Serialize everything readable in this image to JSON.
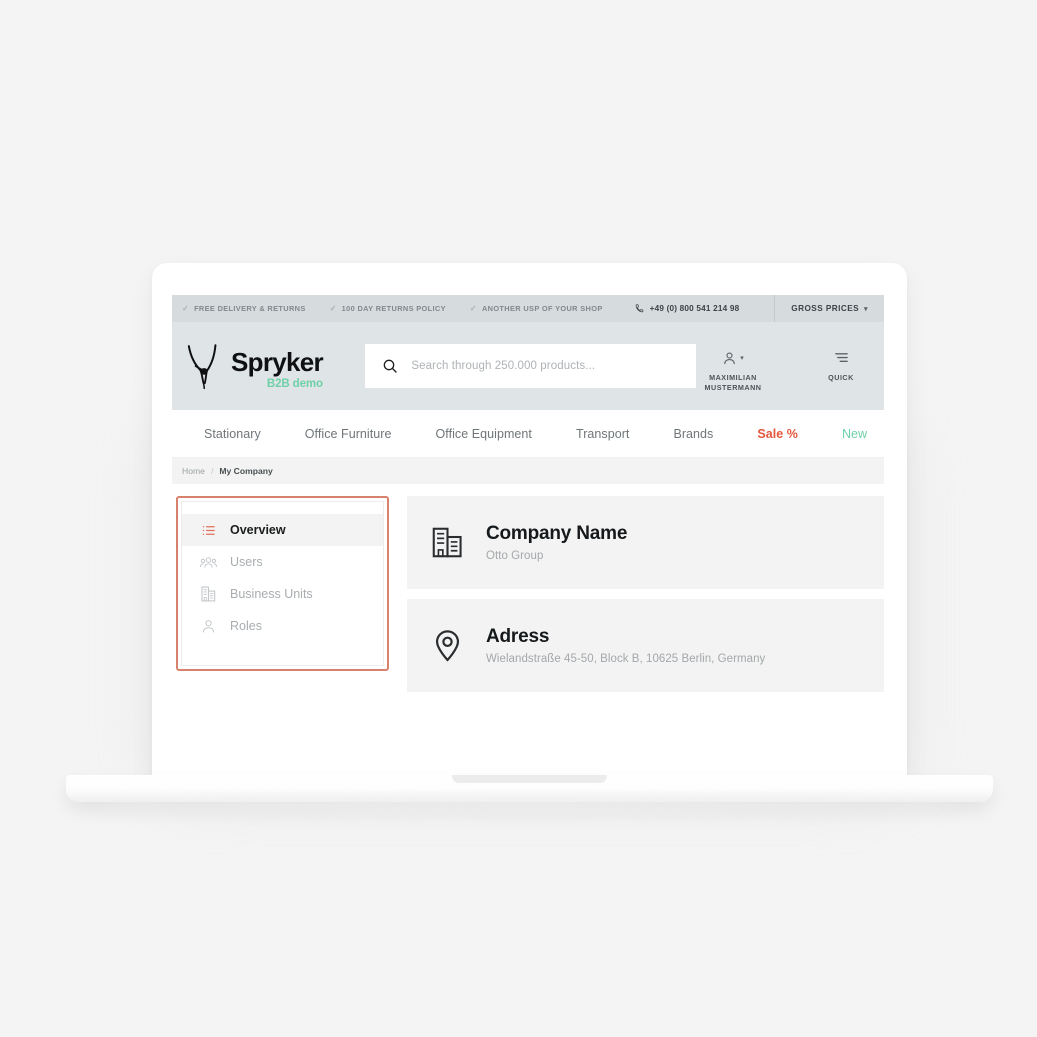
{
  "utility_bar": {
    "usps": [
      "FREE DELIVERY & RETURNS",
      "100 DAY RETURNS POLICY",
      "ANOTHER USP OF YOUR SHOP"
    ],
    "phone": "+49 (0) 800 541 214 98",
    "price_mode": "GROSS PRICES"
  },
  "header": {
    "logo_word": "Spryker",
    "logo_sub": "B2B demo",
    "search_placeholder": "Search through 250.000 products...",
    "search_value": "",
    "account_label": "MAXIMILIAN\nMUSTERMANN",
    "account_line1": "MAXIMILIAN",
    "account_line2": "MUSTERMANN",
    "quick_label": "QUICK"
  },
  "nav": {
    "items": [
      {
        "label": "Stationary",
        "style": "normal"
      },
      {
        "label": "Office Furniture",
        "style": "normal"
      },
      {
        "label": "Office Equipment",
        "style": "normal"
      },
      {
        "label": "Transport",
        "style": "normal"
      },
      {
        "label": "Brands",
        "style": "normal"
      },
      {
        "label": "Sale %",
        "style": "sale"
      },
      {
        "label": "New",
        "style": "new"
      }
    ]
  },
  "breadcrumb": {
    "home": "Home",
    "separator": "/",
    "current": "My Company"
  },
  "sidebar": {
    "items": [
      {
        "label": "Overview",
        "icon": "list-icon",
        "active": true
      },
      {
        "label": "Users",
        "icon": "users-icon",
        "active": false
      },
      {
        "label": "Business Units",
        "icon": "building-icon",
        "active": false
      },
      {
        "label": "Roles",
        "icon": "person-icon",
        "active": false
      }
    ]
  },
  "main": {
    "cards": [
      {
        "icon": "building-icon",
        "title": "Company Name",
        "value": "Otto Group"
      },
      {
        "icon": "location-pin-icon",
        "title": "Adress",
        "value": "Wielandstraße 45-50, Block B, 10625 Berlin, Germany"
      }
    ]
  },
  "colors": {
    "background": "#f4f4f4",
    "utility_bar": "#d6dbdd",
    "header": "#dfe4e6",
    "accent_sale": "#e4573d",
    "accent_new": "#6fd0a8",
    "annotation_border": "#d8826c",
    "card_background": "#f3f3f3"
  }
}
